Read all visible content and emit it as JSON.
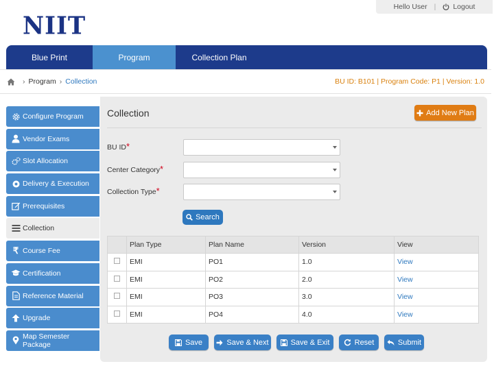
{
  "userbar": {
    "greeting": "Hello User",
    "logout": "Logout"
  },
  "logo": "NIIT",
  "nav": {
    "tabs": [
      {
        "label": "Blue Print"
      },
      {
        "label": "Program"
      },
      {
        "label": "Collection Plan"
      }
    ],
    "active": "Program"
  },
  "breadcrumb": {
    "items": [
      "Program",
      "Collection"
    ],
    "info": "BU ID: B101 | Program Code: P1 | Version: 1.0"
  },
  "sidebar": {
    "items": [
      {
        "label": "Configure Program",
        "icon": "gear-icon"
      },
      {
        "label": "Vendor Exams",
        "icon": "user-icon"
      },
      {
        "label": "Slot Allocation",
        "icon": "gears-icon"
      },
      {
        "label": "Delivery & Execution",
        "icon": "settings-icon"
      },
      {
        "label": "Prerequisites",
        "icon": "edit-icon"
      },
      {
        "label": "Collection",
        "icon": "list-icon"
      },
      {
        "label": "Course Fee",
        "icon": "rupee-icon"
      },
      {
        "label": "Certification",
        "icon": "graduation-cap-icon"
      },
      {
        "label": "Reference Material",
        "icon": "document-icon"
      },
      {
        "label": "Upgrade",
        "icon": "arrow-up-icon"
      },
      {
        "label": "Map Semester Package",
        "icon": "map-marker-icon"
      }
    ],
    "active": "Collection"
  },
  "panel": {
    "title": "Collection",
    "add_button": "Add New Plan",
    "fields": [
      {
        "label": "BU ID",
        "value": ""
      },
      {
        "label": "Center Category",
        "value": ""
      },
      {
        "label": "Collection Type",
        "value": ""
      }
    ],
    "search_button": "Search"
  },
  "table": {
    "headers": [
      "Plan Type",
      "Plan Name",
      "Version",
      "View"
    ],
    "rows": [
      {
        "plan_type": "EMI",
        "plan_name": "PO1",
        "version": "1.0",
        "view": "View"
      },
      {
        "plan_type": "EMI",
        "plan_name": "PO2",
        "version": "2.0",
        "view": "View"
      },
      {
        "plan_type": "EMI",
        "plan_name": "PO3",
        "version": "3.0",
        "view": "View"
      },
      {
        "plan_type": "EMI",
        "plan_name": "PO4",
        "version": "4.0",
        "view": "View"
      }
    ]
  },
  "actions": {
    "save": "Save",
    "save_next": "Save & Next",
    "save_exit": "Save & Exit",
    "reset": "Reset",
    "submit": "Submit"
  },
  "colors": {
    "nav": "#1d3b8b",
    "accent": "#4a8ccd",
    "orange": "#e07c14",
    "link": "#2e78be"
  }
}
